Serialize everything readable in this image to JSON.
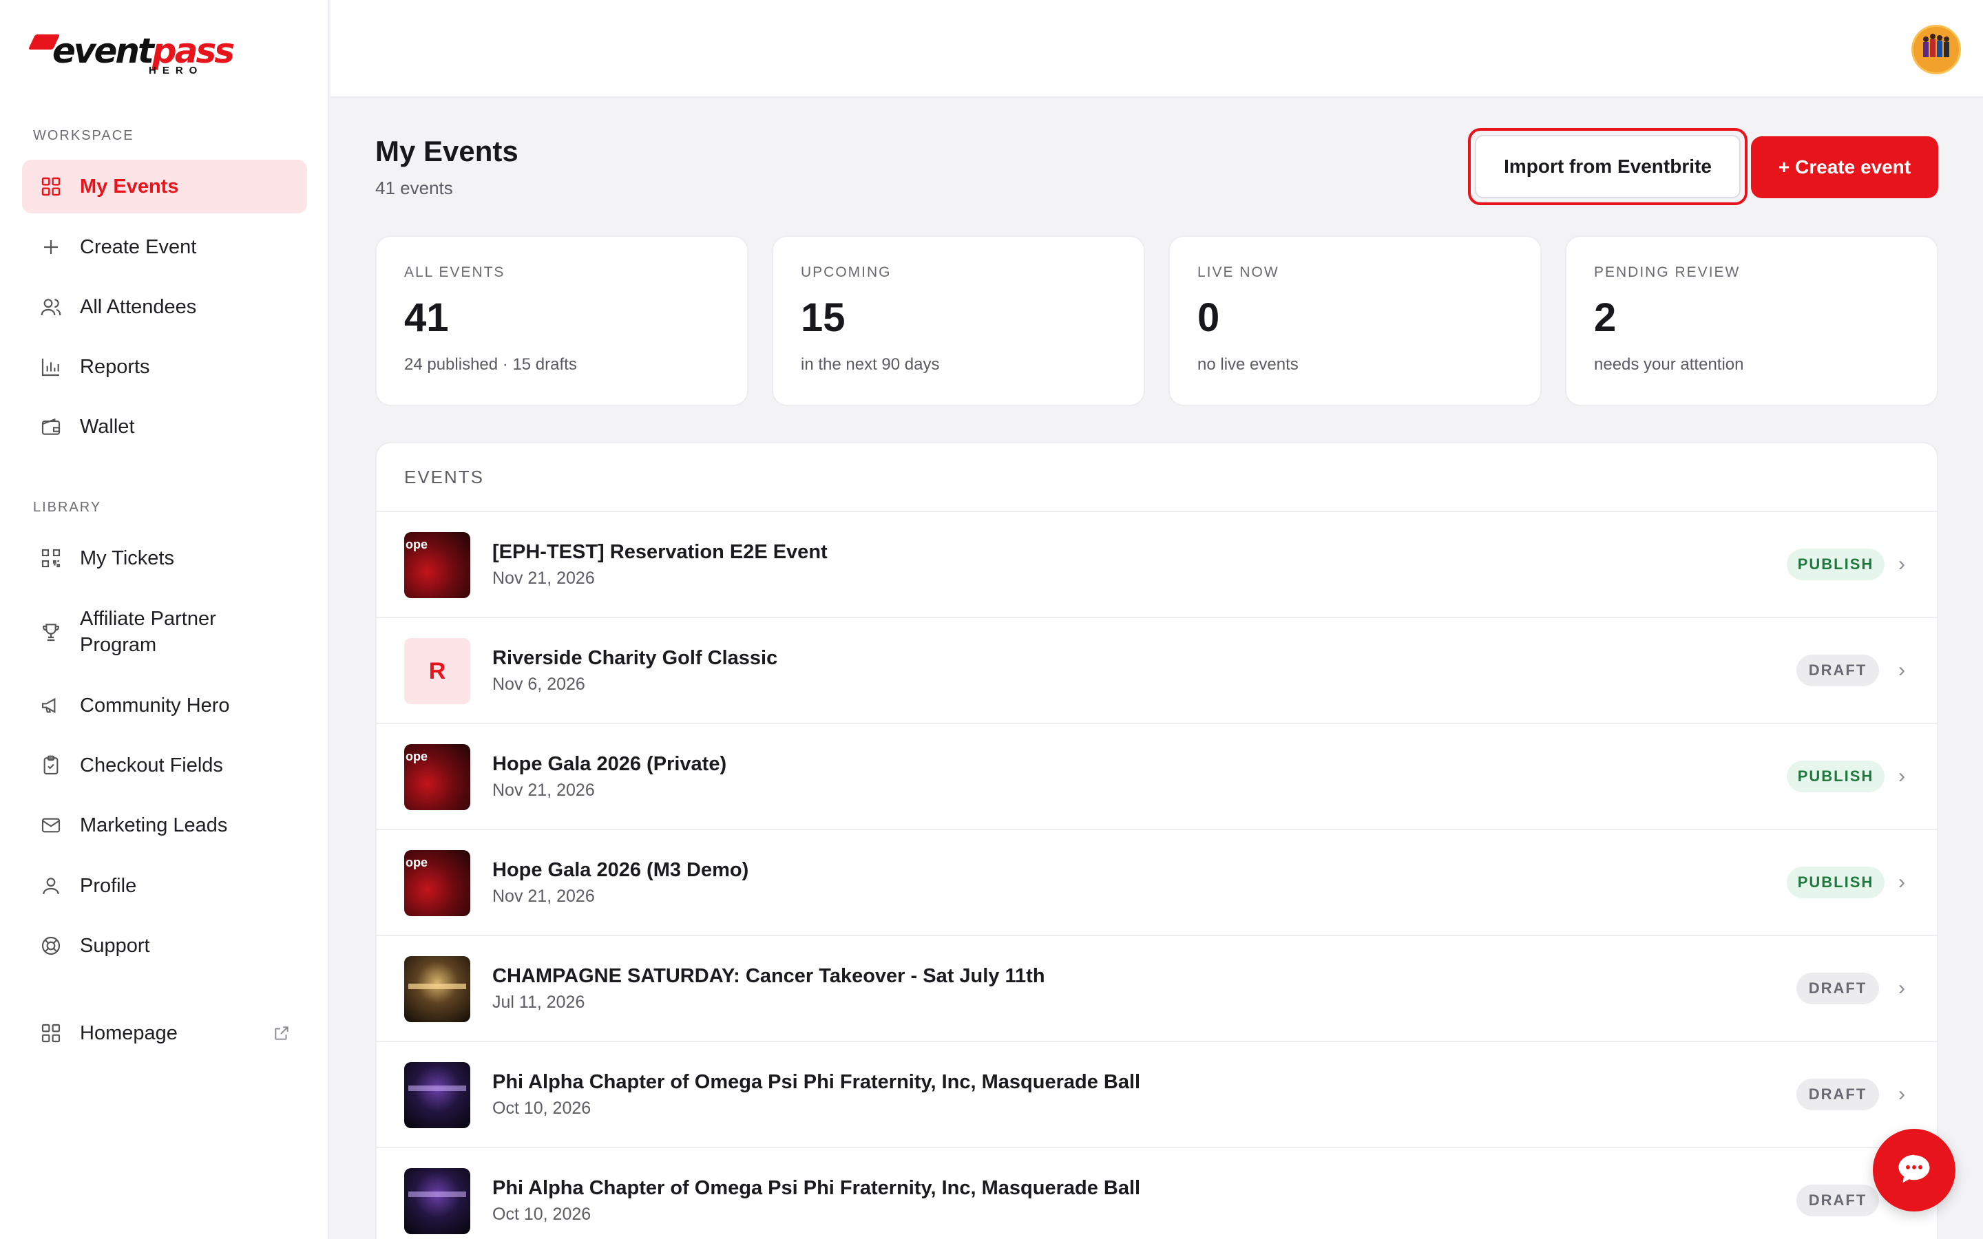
{
  "brand": {
    "logo_text_a": "event",
    "logo_text_b": "pass",
    "logo_sub": "HERO",
    "accent": "#e8141b"
  },
  "sidebar": {
    "workspace_label": "WORKSPACE",
    "library_label": "LIBRARY",
    "workspace_items": [
      {
        "label": "My Events",
        "icon": "grid-icon",
        "active": true
      },
      {
        "label": "Create Event",
        "icon": "plus-icon"
      },
      {
        "label": "All Attendees",
        "icon": "users-icon"
      },
      {
        "label": "Reports",
        "icon": "bar-chart-icon"
      },
      {
        "label": "Wallet",
        "icon": "wallet-icon"
      }
    ],
    "library_items": [
      {
        "label": "My Tickets",
        "icon": "qr-code-icon"
      },
      {
        "label": "Affiliate Partner Program",
        "icon": "trophy-icon"
      },
      {
        "label": "Community Hero",
        "icon": "megaphone-icon"
      },
      {
        "label": "Checkout Fields",
        "icon": "clipboard-check-icon"
      },
      {
        "label": "Marketing Leads",
        "icon": "mail-icon"
      },
      {
        "label": "Profile",
        "icon": "user-icon"
      },
      {
        "label": "Support",
        "icon": "lifebuoy-icon"
      }
    ],
    "homepage": {
      "label": "Homepage",
      "icon": "grid-icon",
      "ext_icon": "external-link-icon"
    }
  },
  "header": {
    "title": "My Events",
    "subtitle": "41 events",
    "import_label": "Import from Eventbrite",
    "create_label": "+ Create event"
  },
  "stats": [
    {
      "label": "ALL EVENTS",
      "value": "41",
      "note": "24 published · 15 drafts"
    },
    {
      "label": "UPCOMING",
      "value": "15",
      "note": "in the next 90 days"
    },
    {
      "label": "LIVE NOW",
      "value": "0",
      "note": "no live events"
    },
    {
      "label": "PENDING REVIEW",
      "value": "2",
      "note": "needs your attention"
    }
  ],
  "events": {
    "heading": "EVENTS",
    "rows": [
      {
        "title": "[EPH-TEST] Reservation E2E Event",
        "date": "Nov 21, 2026",
        "status": "PUBLISH",
        "thumb": "gala",
        "thumb_text": "ope"
      },
      {
        "title": "Riverside Charity Golf Classic",
        "date": "Nov 6, 2026",
        "status": "DRAFT",
        "thumb": "letter",
        "thumb_text": "R"
      },
      {
        "title": "Hope Gala 2026 (Private)",
        "date": "Nov 21, 2026",
        "status": "PUBLISH",
        "thumb": "gala",
        "thumb_text": "ope"
      },
      {
        "title": "Hope Gala 2026 (M3 Demo)",
        "date": "Nov 21, 2026",
        "status": "PUBLISH",
        "thumb": "gala",
        "thumb_text": "ope"
      },
      {
        "title": "CHAMPAGNE SATURDAY: Cancer Takeover - Sat July 11th",
        "date": "Jul 11, 2026",
        "status": "DRAFT",
        "thumb": "champ",
        "thumb_text": ""
      },
      {
        "title": "Phi Alpha Chapter of Omega Psi Phi Fraternity, Inc, Masquerade Ball",
        "date": "Oct 10, 2026",
        "status": "DRAFT",
        "thumb": "masq",
        "thumb_text": ""
      },
      {
        "title": "Phi Alpha Chapter of Omega Psi Phi Fraternity, Inc, Masquerade Ball",
        "date": "Oct 10, 2026",
        "status": "DRAFT",
        "thumb": "masq",
        "thumb_text": ""
      }
    ]
  },
  "chat": {
    "icon": "chat-bubble-icon"
  }
}
